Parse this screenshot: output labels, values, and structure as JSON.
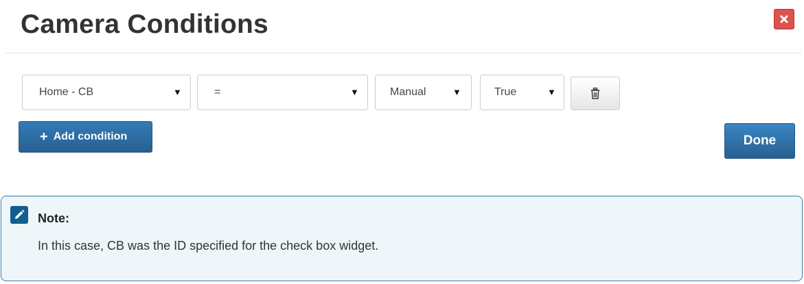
{
  "dialog": {
    "title": "Camera Conditions",
    "close_label": "×"
  },
  "condition_row": {
    "field": "Home - CB",
    "operator": "=",
    "mode": "Manual",
    "value": "True",
    "arrow": "▼"
  },
  "buttons": {
    "add_condition": "Add condition",
    "add_icon": "+",
    "done": "Done"
  },
  "note": {
    "title": "Note:",
    "body": "In this case, CB was the ID specified for the check box widget."
  },
  "colors": {
    "close": "#d9534f",
    "primary": "#286090",
    "note_border": "#2f7ea3",
    "note_bg": "#eef6f9"
  },
  "icons": {
    "close": "close-icon",
    "delete": "trash-icon",
    "add": "plus-icon",
    "note": "pencil-icon"
  }
}
